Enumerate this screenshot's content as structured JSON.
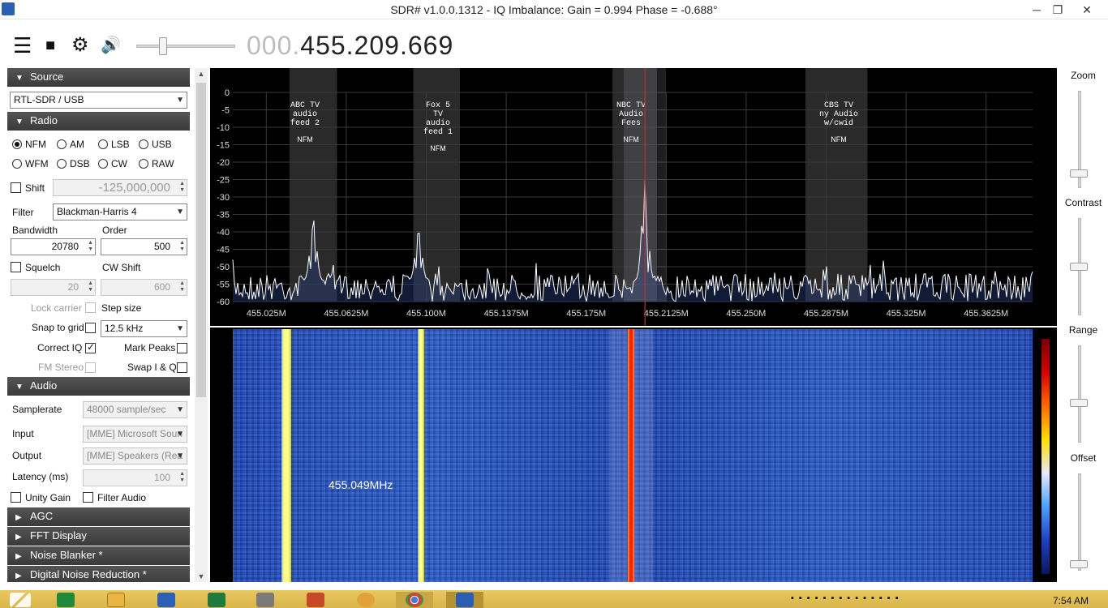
{
  "window": {
    "title": "SDR# v1.0.0.1312 - IQ Imbalance: Gain = 0.994 Phase = -0.688°",
    "minimize": "─",
    "maximize": "❐",
    "close": "✕"
  },
  "toolbar": {
    "menu_icon": "☰",
    "stop_icon": "■",
    "settings_icon": "⚙",
    "audio_icon": "🔊",
    "frequency_dim": "000.",
    "frequency": "455.209.669"
  },
  "source": {
    "header": "Source",
    "device": "RTL-SDR / USB"
  },
  "radio": {
    "header": "Radio",
    "modes": [
      "NFM",
      "AM",
      "LSB",
      "USB",
      "WFM",
      "DSB",
      "CW",
      "RAW"
    ],
    "selected_mode": "NFM",
    "shift_label": "Shift",
    "shift_value": "-125,000,000",
    "filter_label": "Filter",
    "filter_value": "Blackman-Harris 4",
    "bandwidth_label": "Bandwidth",
    "bandwidth_value": "20780",
    "order_label": "Order",
    "order_value": "500",
    "squelch_label": "Squelch",
    "squelch_value": "20",
    "cw_shift_label": "CW Shift",
    "cw_shift_value": "600",
    "lock_carrier_label": "Lock carrier",
    "step_size_label": "Step size",
    "snap_to_grid_label": "Snap to grid",
    "step_size_value": "12.5 kHz",
    "correct_iq_label": "Correct IQ",
    "mark_peaks_label": "Mark Peaks",
    "fm_stereo_label": "FM Stereo",
    "swap_iq_label": "Swap I & Q"
  },
  "audio": {
    "header": "Audio",
    "samplerate_label": "Samplerate",
    "samplerate_value": "48000 sample/sec",
    "input_label": "Input",
    "input_value": "[MME] Microsoft Soun",
    "output_label": "Output",
    "output_value": "[MME] Speakers (Rea",
    "latency_label": "Latency (ms)",
    "latency_value": "100",
    "unity_gain_label": "Unity Gain",
    "filter_audio_label": "Filter Audio"
  },
  "collapsed_sections": [
    "AGC",
    "FFT Display",
    "Noise Blanker *",
    "Digital Noise Reduction *"
  ],
  "spectrum": {
    "y_ticks": [
      "0",
      "-5",
      "-10",
      "-15",
      "-20",
      "-25",
      "-30",
      "-35",
      "-40",
      "-45",
      "-50",
      "-55",
      "-60"
    ],
    "x_ticks": [
      "455.025M",
      "455.0625M",
      "455.100M",
      "455.1375M",
      "455.175M",
      "455.2125M",
      "455.250M",
      "455.2875M",
      "455.325M",
      "455.3625M"
    ],
    "bookmarks": [
      {
        "name": "ABC TV\naudio\nfeed 2",
        "mode": "NFM"
      },
      {
        "name": "Fox 5\nTV\naudio\nfeed 1",
        "mode": "NFM"
      },
      {
        "name": "NBC TV\nAudio\nFees",
        "mode": "NFM"
      },
      {
        "name": "CBS TV\nny Audio\nw/cwid",
        "mode": "NFM"
      }
    ],
    "peaks": [
      {
        "freq_mhz": 455.049,
        "level_db": -35
      },
      {
        "freq_mhz": 455.1,
        "level_db": -38
      },
      {
        "freq_mhz": 455.2097,
        "level_db": -25
      }
    ],
    "noise_floor_db": [
      -52,
      -57
    ]
  },
  "waterfall": {
    "hover_label": "455.049MHz"
  },
  "right_panel": {
    "zoom_label": "Zoom",
    "contrast_label": "Contrast",
    "range_label": "Range",
    "offset_label": "Offset",
    "zoom_level": 0.12,
    "contrast_level": 0.5,
    "range_level": 0.4,
    "offset_level": 0.03
  },
  "taskbar": {
    "clock": "7:54 AM",
    "apps": [
      "start",
      "calculator",
      "file-explorer",
      "word",
      "excel",
      "sdr-tool",
      "powerpoint",
      "paint",
      "chrome",
      "sdrsharp"
    ]
  }
}
